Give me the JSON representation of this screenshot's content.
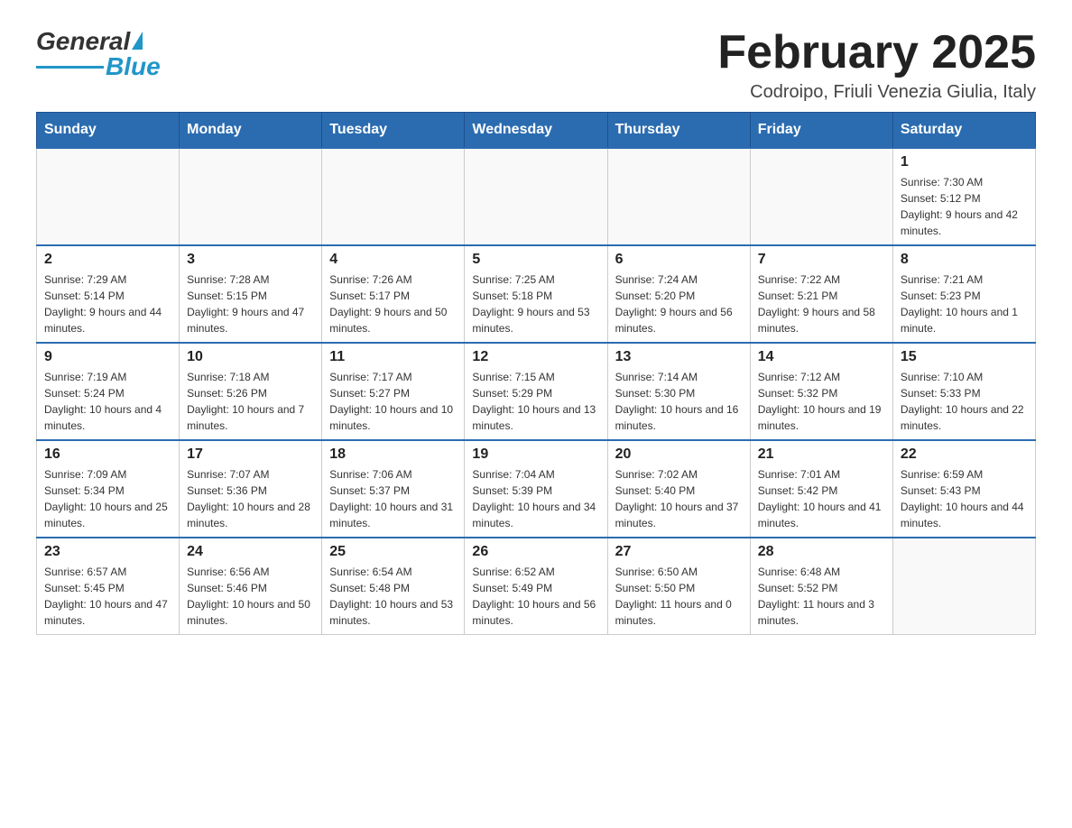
{
  "header": {
    "logo_general": "General",
    "logo_blue": "Blue",
    "title": "February 2025",
    "subtitle": "Codroipo, Friuli Venezia Giulia, Italy"
  },
  "days_of_week": [
    "Sunday",
    "Monday",
    "Tuesday",
    "Wednesday",
    "Thursday",
    "Friday",
    "Saturday"
  ],
  "weeks": [
    [
      {
        "day": "",
        "sunrise": "",
        "sunset": "",
        "daylight": ""
      },
      {
        "day": "",
        "sunrise": "",
        "sunset": "",
        "daylight": ""
      },
      {
        "day": "",
        "sunrise": "",
        "sunset": "",
        "daylight": ""
      },
      {
        "day": "",
        "sunrise": "",
        "sunset": "",
        "daylight": ""
      },
      {
        "day": "",
        "sunrise": "",
        "sunset": "",
        "daylight": ""
      },
      {
        "day": "",
        "sunrise": "",
        "sunset": "",
        "daylight": ""
      },
      {
        "day": "1",
        "sunrise": "Sunrise: 7:30 AM",
        "sunset": "Sunset: 5:12 PM",
        "daylight": "Daylight: 9 hours and 42 minutes."
      }
    ],
    [
      {
        "day": "2",
        "sunrise": "Sunrise: 7:29 AM",
        "sunset": "Sunset: 5:14 PM",
        "daylight": "Daylight: 9 hours and 44 minutes."
      },
      {
        "day": "3",
        "sunrise": "Sunrise: 7:28 AM",
        "sunset": "Sunset: 5:15 PM",
        "daylight": "Daylight: 9 hours and 47 minutes."
      },
      {
        "day": "4",
        "sunrise": "Sunrise: 7:26 AM",
        "sunset": "Sunset: 5:17 PM",
        "daylight": "Daylight: 9 hours and 50 minutes."
      },
      {
        "day": "5",
        "sunrise": "Sunrise: 7:25 AM",
        "sunset": "Sunset: 5:18 PM",
        "daylight": "Daylight: 9 hours and 53 minutes."
      },
      {
        "day": "6",
        "sunrise": "Sunrise: 7:24 AM",
        "sunset": "Sunset: 5:20 PM",
        "daylight": "Daylight: 9 hours and 56 minutes."
      },
      {
        "day": "7",
        "sunrise": "Sunrise: 7:22 AM",
        "sunset": "Sunset: 5:21 PM",
        "daylight": "Daylight: 9 hours and 58 minutes."
      },
      {
        "day": "8",
        "sunrise": "Sunrise: 7:21 AM",
        "sunset": "Sunset: 5:23 PM",
        "daylight": "Daylight: 10 hours and 1 minute."
      }
    ],
    [
      {
        "day": "9",
        "sunrise": "Sunrise: 7:19 AM",
        "sunset": "Sunset: 5:24 PM",
        "daylight": "Daylight: 10 hours and 4 minutes."
      },
      {
        "day": "10",
        "sunrise": "Sunrise: 7:18 AM",
        "sunset": "Sunset: 5:26 PM",
        "daylight": "Daylight: 10 hours and 7 minutes."
      },
      {
        "day": "11",
        "sunrise": "Sunrise: 7:17 AM",
        "sunset": "Sunset: 5:27 PM",
        "daylight": "Daylight: 10 hours and 10 minutes."
      },
      {
        "day": "12",
        "sunrise": "Sunrise: 7:15 AM",
        "sunset": "Sunset: 5:29 PM",
        "daylight": "Daylight: 10 hours and 13 minutes."
      },
      {
        "day": "13",
        "sunrise": "Sunrise: 7:14 AM",
        "sunset": "Sunset: 5:30 PM",
        "daylight": "Daylight: 10 hours and 16 minutes."
      },
      {
        "day": "14",
        "sunrise": "Sunrise: 7:12 AM",
        "sunset": "Sunset: 5:32 PM",
        "daylight": "Daylight: 10 hours and 19 minutes."
      },
      {
        "day": "15",
        "sunrise": "Sunrise: 7:10 AM",
        "sunset": "Sunset: 5:33 PM",
        "daylight": "Daylight: 10 hours and 22 minutes."
      }
    ],
    [
      {
        "day": "16",
        "sunrise": "Sunrise: 7:09 AM",
        "sunset": "Sunset: 5:34 PM",
        "daylight": "Daylight: 10 hours and 25 minutes."
      },
      {
        "day": "17",
        "sunrise": "Sunrise: 7:07 AM",
        "sunset": "Sunset: 5:36 PM",
        "daylight": "Daylight: 10 hours and 28 minutes."
      },
      {
        "day": "18",
        "sunrise": "Sunrise: 7:06 AM",
        "sunset": "Sunset: 5:37 PM",
        "daylight": "Daylight: 10 hours and 31 minutes."
      },
      {
        "day": "19",
        "sunrise": "Sunrise: 7:04 AM",
        "sunset": "Sunset: 5:39 PM",
        "daylight": "Daylight: 10 hours and 34 minutes."
      },
      {
        "day": "20",
        "sunrise": "Sunrise: 7:02 AM",
        "sunset": "Sunset: 5:40 PM",
        "daylight": "Daylight: 10 hours and 37 minutes."
      },
      {
        "day": "21",
        "sunrise": "Sunrise: 7:01 AM",
        "sunset": "Sunset: 5:42 PM",
        "daylight": "Daylight: 10 hours and 41 minutes."
      },
      {
        "day": "22",
        "sunrise": "Sunrise: 6:59 AM",
        "sunset": "Sunset: 5:43 PM",
        "daylight": "Daylight: 10 hours and 44 minutes."
      }
    ],
    [
      {
        "day": "23",
        "sunrise": "Sunrise: 6:57 AM",
        "sunset": "Sunset: 5:45 PM",
        "daylight": "Daylight: 10 hours and 47 minutes."
      },
      {
        "day": "24",
        "sunrise": "Sunrise: 6:56 AM",
        "sunset": "Sunset: 5:46 PM",
        "daylight": "Daylight: 10 hours and 50 minutes."
      },
      {
        "day": "25",
        "sunrise": "Sunrise: 6:54 AM",
        "sunset": "Sunset: 5:48 PM",
        "daylight": "Daylight: 10 hours and 53 minutes."
      },
      {
        "day": "26",
        "sunrise": "Sunrise: 6:52 AM",
        "sunset": "Sunset: 5:49 PM",
        "daylight": "Daylight: 10 hours and 56 minutes."
      },
      {
        "day": "27",
        "sunrise": "Sunrise: 6:50 AM",
        "sunset": "Sunset: 5:50 PM",
        "daylight": "Daylight: 11 hours and 0 minutes."
      },
      {
        "day": "28",
        "sunrise": "Sunrise: 6:48 AM",
        "sunset": "Sunset: 5:52 PM",
        "daylight": "Daylight: 11 hours and 3 minutes."
      },
      {
        "day": "",
        "sunrise": "",
        "sunset": "",
        "daylight": ""
      }
    ]
  ]
}
